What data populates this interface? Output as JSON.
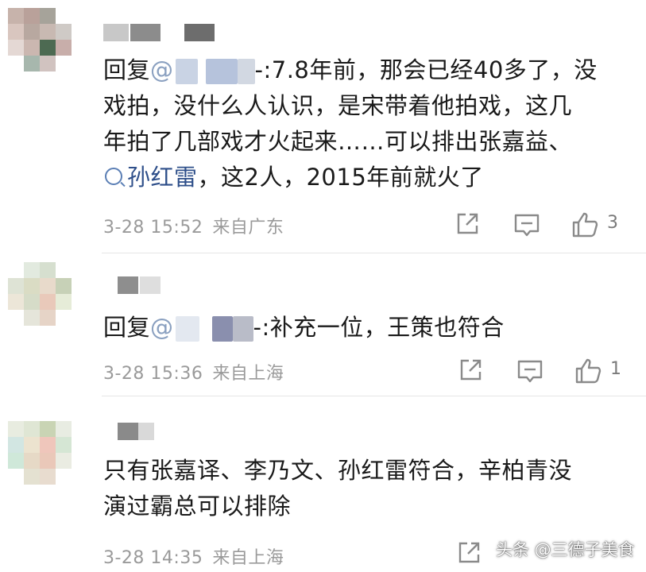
{
  "comments": [
    {
      "reply_prefix": "回复",
      "at": "@",
      "text_line1": "-:7.8年前，那会已经40多了，没",
      "text_line2": "戏拍，没什么人认识，是宋带着他拍戏，这几",
      "text_line3": "年拍了几部戏才火起来……可以排出张嘉益、",
      "topic": "孙红雷",
      "text_line4_rest": "，这2人，2015年前就火了",
      "time": "3-28 15:52",
      "location": "来自广东",
      "likes": "3"
    },
    {
      "reply_prefix": "回复",
      "at": "@",
      "text_line1": "-:补充一位，王策也符合",
      "time": "3-28 15:36",
      "location": "来自上海",
      "likes": "1"
    },
    {
      "text_line1": "只有张嘉译、李乃文、孙红雷符合，辛柏青没",
      "text_line2": "演过霸总可以排除",
      "time": "3-28 14:35",
      "location": "来自上海"
    }
  ],
  "watermark": "头条 @三德子美食",
  "icons": {
    "share": "share-icon",
    "comment": "comment-icon",
    "like": "thumbs-up-icon",
    "topic": "search-icon"
  },
  "colors": {
    "meta_text": "#9a9a9a",
    "topic_link": "#2e4f8a",
    "divider": "#e6e6e6"
  }
}
